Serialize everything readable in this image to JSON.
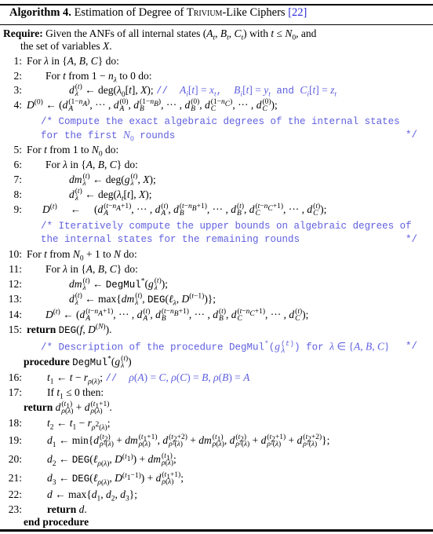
{
  "caption": {
    "label": "Algorithm 4.",
    "title_pre": "Estimation of Degree of",
    "title_sc": "Trivium",
    "title_post": "-Like Ciphers",
    "citation": "[22]"
  },
  "colors": {
    "comment": "#5f5fe0",
    "citation": "#2a2ad8",
    "text": "#000000"
  },
  "require": {
    "keyword": "Require:",
    "text1": "Given the ANFs of all internal states (A_t, B_t, C_t) with t ≤ N_0, and",
    "text2": "the set of variables X."
  },
  "lines": [
    {
      "n": "1:",
      "text": "For λ in {A, B, C} do:"
    },
    {
      "n": "2:",
      "text": "For t from 1 − n_λ to 0 do:"
    },
    {
      "n": "3:",
      "text": "d_λ^(t) ← deg(λ_0[t], X);",
      "comment": "// A_i[t] = x_t , B_i[t] = y_t and C_i[t] = z_t"
    },
    {
      "n": "4:",
      "text": "D^(0) ← (d_A^(1−n_A), ··· , d_A^(0), d_B^(1−n_B), ··· , d_B^(0), d_C^(1−n_C), ··· , d_C^(0));"
    },
    {
      "n": "",
      "comment": "/* Compute the exact algebraic degrees of the internal states",
      "comment2": "for the first N_0 rounds",
      "end": "*/"
    },
    {
      "n": "5:",
      "text": "For t from 1 to N_0 do:"
    },
    {
      "n": "6:",
      "text": "For λ in {A, B, C} do:"
    },
    {
      "n": "7:",
      "text": "dm_λ^(t) ← deg(g_λ^(t), X);"
    },
    {
      "n": "8:",
      "text": "d_λ^(t) ← deg(λ_t[t], X);"
    },
    {
      "n": "9:",
      "text": "D^(t) ← (d_A^(t−n_A+1), ··· , d_A^(t), d_B^(t−n_B+1), ··· , d_B^(t), d_C^(t−n_C+1), ··· , d_C^(t));"
    },
    {
      "n": "",
      "comment": "/* Iteratively compute the upper bounds on algebraic degrees of",
      "comment2": "the internal states for the remaining rounds",
      "end": "*/"
    },
    {
      "n": "10:",
      "text": "For t from N_0 + 1 to N do:"
    },
    {
      "n": "11:",
      "text": "For λ in {A, B, C} do:"
    },
    {
      "n": "12:",
      "text": "dm_λ^(t) ← DegMul*(g_λ^(t));"
    },
    {
      "n": "13:",
      "text": "d_λ^(t) ← max{dm_λ^(t), DEG(ℓ_λ, D^(t−1))};"
    },
    {
      "n": "14:",
      "text": "D^(t) ← (d_A^(t−n_A+1), ··· , d_A^(t), d_B^(t−n_B+1), ··· , d_B^(t), d_C^(t−n_C+1), ··· , d_C^(t));"
    },
    {
      "n": "15:",
      "text": "return DEG(f, D^(N))."
    },
    {
      "n": "",
      "comment": "/* Description of the procedure DegMul*(g_λ^(t)) for λ ∈ {A, B, C}",
      "end": "*/"
    },
    {
      "n": "",
      "text": "procedure DegMul*(g_λ^(t))"
    },
    {
      "n": "16:",
      "text": "t_1 ← t − r_ρ(λ);",
      "comment": "// ρ(A) = C, ρ(C) = B, ρ(B) = A"
    },
    {
      "n": "17:",
      "text": "If t_1 ≤ 0 then:"
    },
    {
      "n": "",
      "text": "return d_ρ(λ)^(t_1) + d_ρ(λ)^(t_1+1)."
    },
    {
      "n": "18:",
      "text": "t_2 ← t_1 − r_ρ²(λ);"
    },
    {
      "n": "19:",
      "text": "d_1 ← min{d_ρ²(λ)^(t_2) + dm_ρ(λ)^(t_1+1), d_ρ²(λ)^(t_2+2) + dm_ρ(λ)^(t_1), d_ρ²(λ)^(t_2) + d_ρ²(λ)^(t_2+1) + d_ρ²(λ)^(t_2+2)};"
    },
    {
      "n": "20:",
      "text": "d_2 ← DEG(ℓ_ρ(λ), D^(t_1)) + dm_ρ(λ)^(t_1);"
    },
    {
      "n": "21:",
      "text": "d_3 ← DEG(ℓ_ρ(λ), D^(t_1−1)) + d_ρ(λ)^(t_1+1);"
    },
    {
      "n": "22:",
      "text": "d ← max{d_1, d_2, d_3};"
    },
    {
      "n": "23:",
      "text": "return d."
    },
    {
      "n": "",
      "text": "end procedure"
    }
  ]
}
